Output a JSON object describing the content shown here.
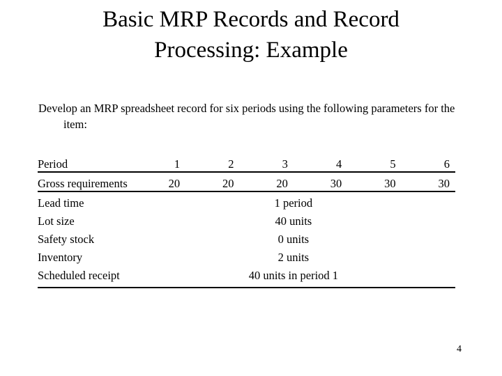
{
  "slide": {
    "title_lines": [
      "Basic MRP Records and Record",
      "Processing: Example"
    ],
    "body_paragraph": "Develop an MRP spreadsheet record for six periods using the following parameters for the item:",
    "page_number": "4"
  },
  "table": {
    "period_label": "Period",
    "period_values": [
      "1",
      "2",
      "3",
      "4",
      "5",
      "6"
    ],
    "gross_label": "Gross requirements",
    "gross_values": [
      "20",
      "20",
      "20",
      "30",
      "30",
      "30"
    ],
    "parameters": [
      {
        "label": "Lead time",
        "value": "1 period"
      },
      {
        "label": "Lot size",
        "value": "40 units"
      },
      {
        "label": "Safety stock",
        "value": "0 units"
      },
      {
        "label": "Inventory",
        "value": "2 units"
      },
      {
        "label": "Scheduled receipt",
        "value": "40 units in period 1"
      }
    ]
  },
  "colors": {
    "background": "#ffffff",
    "text": "#000000",
    "rule": "#000000"
  }
}
